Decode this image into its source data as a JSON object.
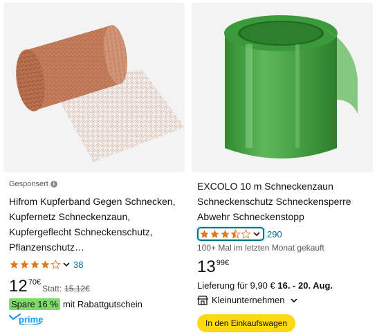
{
  "products": [
    {
      "sponsored_label": "Gesponsert",
      "title": "Hifrom Kupferband Gegen Schnecken, Kupfernetz Schneckenzaun, Kupfergeflecht Schneckenschutz, Pflanzenschutz…",
      "image_icon": "copper-mesh-roll",
      "rating": 4.0,
      "rating_count": "38",
      "price_whole": "12",
      "price_fraction": "70",
      "currency": "€",
      "was_label": "Statt:",
      "was_price": "15,12€",
      "savings_badge": "Spare 16 %",
      "coupon_text": "mit Rabattgutschein",
      "prime_label": "prime"
    },
    {
      "title": "EXCOLO 10 m Schneckenzaun Schneckenschutz Schneckensperre Abwehr Schneckenstopp",
      "image_icon": "green-plastic-roll",
      "rating": 3.5,
      "rating_count": "290",
      "bought_text": "100+ Mal im letzten Monat gekauft",
      "price_whole": "13",
      "price_fraction": "99",
      "currency": "€",
      "delivery_prefix": "Lieferung für 9,90 €",
      "delivery_date": "16. - 20. Aug.",
      "seller_badge": "Kleinunternehmen",
      "cart_button": "In den Einkaufswagen"
    }
  ],
  "colors": {
    "star": "#de7921",
    "link": "#007185",
    "savings_badge": "#7fda69",
    "cart_button": "#ffd814",
    "prime": "#1399ff"
  }
}
